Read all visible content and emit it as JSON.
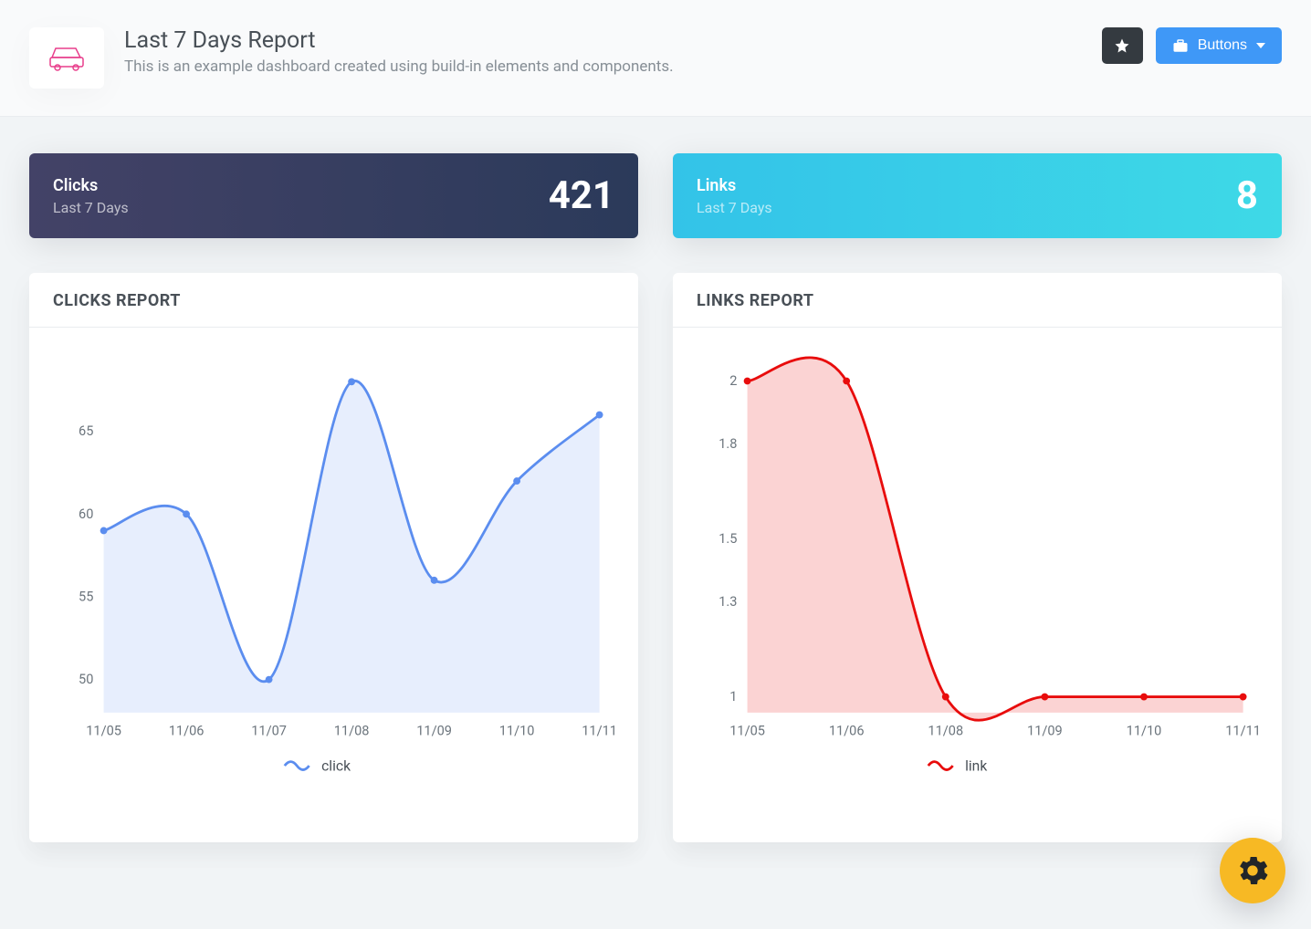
{
  "header": {
    "title": "Last 7 Days Report",
    "subtitle": "This is an example dashboard created using build-in elements and components.",
    "buttons_label": "Buttons"
  },
  "stats": {
    "clicks": {
      "label": "Clicks",
      "period": "Last 7 Days",
      "value": "421"
    },
    "links": {
      "label": "Links",
      "period": "Last 7 Days",
      "value": "8"
    }
  },
  "cards": {
    "clicks_report_title": "CLICKS REPORT",
    "links_report_title": "LINKS REPORT"
  },
  "chart_data": [
    {
      "id": "clicks",
      "type": "line",
      "categories": [
        "11/05",
        "11/06",
        "11/07",
        "11/08",
        "11/09",
        "11/10",
        "11/11"
      ],
      "series": [
        {
          "name": "click",
          "values": [
            59,
            60,
            50,
            68,
            56,
            62,
            66
          ]
        }
      ],
      "ylabel": "",
      "xlabel": "",
      "yticks": [
        50,
        55,
        60,
        65
      ],
      "ylim": [
        48,
        69
      ],
      "color": "#5b8def",
      "fill": "rgba(91,141,239,0.15)"
    },
    {
      "id": "links",
      "type": "line",
      "categories": [
        "11/05",
        "11/06",
        "11/08",
        "11/09",
        "11/10",
        "11/11"
      ],
      "series": [
        {
          "name": "link",
          "values": [
            2,
            2,
            1,
            1,
            1,
            1
          ]
        }
      ],
      "ylabel": "",
      "xlabel": "",
      "yticks": [
        1,
        1.3,
        1.5,
        1.8,
        2
      ],
      "ylim": [
        0.95,
        2.05
      ],
      "color": "#e80c0c",
      "fill": "rgba(232,12,12,0.18)"
    }
  ]
}
